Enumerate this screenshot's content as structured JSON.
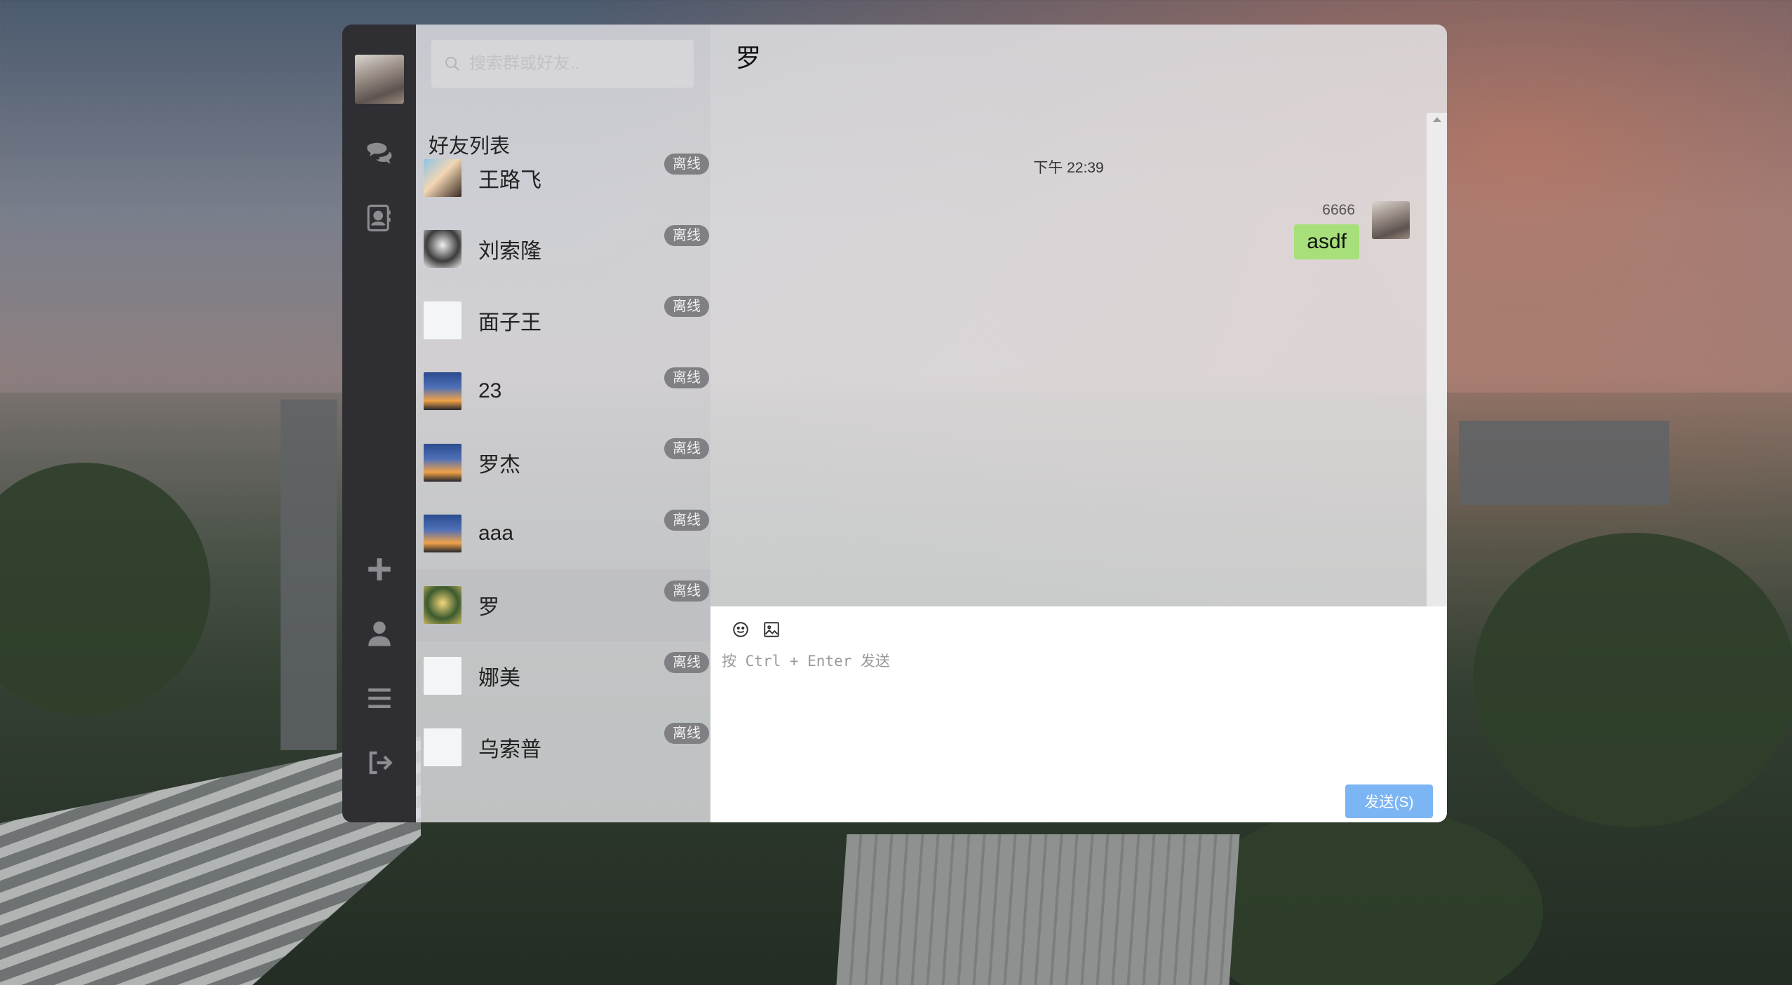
{
  "search": {
    "placeholder": "搜索群或好友.."
  },
  "sidebar": {
    "title": "好友列表",
    "friends": [
      {
        "name": "王路飞",
        "status": "离线",
        "avatar": "anime1"
      },
      {
        "name": "刘索隆",
        "status": "离线",
        "avatar": "anime2"
      },
      {
        "name": "面子王",
        "status": "离线",
        "avatar": "blank"
      },
      {
        "name": "23",
        "status": "离线",
        "avatar": "sunset"
      },
      {
        "name": "罗杰",
        "status": "离线",
        "avatar": "sunset"
      },
      {
        "name": "aaa",
        "status": "离线",
        "avatar": "sunset"
      },
      {
        "name": "罗",
        "status": "离线",
        "avatar": "zoro",
        "active": true
      },
      {
        "name": "娜美",
        "status": "离线",
        "avatar": "blank"
      },
      {
        "name": "乌索普",
        "status": "离线",
        "avatar": "blank"
      }
    ]
  },
  "chat": {
    "title": "罗",
    "time": "下午 22:39",
    "message": {
      "sender": "6666",
      "text": "asdf"
    },
    "composer_placeholder": "按 Ctrl + Enter 发送",
    "send_label": "发送(S)"
  },
  "nav": {
    "icons": [
      "chat-icon",
      "contacts-icon",
      "plus-icon",
      "user-icon",
      "menu-icon",
      "logout-icon"
    ]
  },
  "colors": {
    "nav_bg": "#2e2e33",
    "bubble": "#a7e07a",
    "send": "#7cb5f4",
    "badge": "#7f7f84"
  }
}
